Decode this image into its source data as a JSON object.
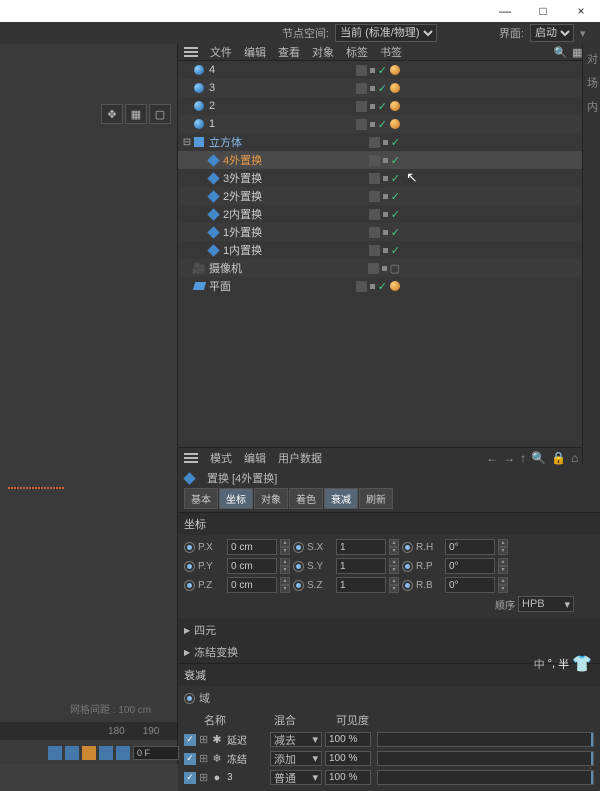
{
  "titlebar": {
    "min": "—",
    "max": "□",
    "close": "×"
  },
  "noderow": {
    "label1": "节点空间:",
    "select1": "当前 (标准/物理)",
    "label2": "界面:",
    "select2": "启动"
  },
  "objmenu": {
    "m1": "文件",
    "m2": "编辑",
    "m3": "查看",
    "m4": "对象",
    "m5": "标签",
    "m6": "书签"
  },
  "tree": {
    "items": [
      {
        "name": "4",
        "type": "sphere",
        "indent": 0
      },
      {
        "name": "3",
        "type": "sphere",
        "indent": 0
      },
      {
        "name": "2",
        "type": "sphere",
        "indent": 0
      },
      {
        "name": "1",
        "type": "sphere",
        "indent": 0
      },
      {
        "name": "立方体",
        "type": "cube",
        "indent": 0,
        "exp": true,
        "blue": true
      },
      {
        "name": "4外置换",
        "type": "def",
        "indent": 1,
        "sel": true,
        "orange": true
      },
      {
        "name": "3外置换",
        "type": "def",
        "indent": 1
      },
      {
        "name": "2外置换",
        "type": "def",
        "indent": 1
      },
      {
        "name": "2内置换",
        "type": "def",
        "indent": 1
      },
      {
        "name": "1外置换",
        "type": "def",
        "indent": 1
      },
      {
        "name": "1内置换",
        "type": "def",
        "indent": 1
      },
      {
        "name": "摄像机",
        "type": "cam",
        "indent": 0
      },
      {
        "name": "平面",
        "type": "plane",
        "indent": 0,
        "mat": true
      }
    ]
  },
  "attrmenu": {
    "m1": "模式",
    "m2": "编辑",
    "m3": "用户数据"
  },
  "attrtitle": "置换 [4外置换]",
  "tabs": {
    "t1": "基本",
    "t2": "坐标",
    "t3": "对象",
    "t4": "着色",
    "t5": "衰减",
    "t6": "刷新"
  },
  "coords": {
    "hdr": "坐标",
    "px": "P.X",
    "py": "P.Y",
    "pz": "P.Z",
    "sx": "S.X",
    "sy": "S.Y",
    "sz": "S.Z",
    "rh": "R.H",
    "rp": "R.P",
    "rb": "R.B",
    "pxv": "0 cm",
    "pyv": "0 cm",
    "pzv": "0 cm",
    "sxv": "1",
    "syv": "1",
    "szv": "1",
    "rhv": "0°",
    "rpv": "0°",
    "rbv": "0°",
    "order": "顺序",
    "orderv": "HPB"
  },
  "quat": "四元",
  "freeze": "冻结变换",
  "falloff": {
    "hdr": "衰减",
    "field": "域",
    "h_name": "名称",
    "h_blend": "混合",
    "h_vis": "可见度",
    "rows": [
      {
        "ic": "✱",
        "name": "延迟",
        "blend": "减去",
        "vis": "100 %"
      },
      {
        "ic": "❄",
        "name": "冻结",
        "blend": "添加",
        "vis": "100 %"
      },
      {
        "ic": "●",
        "name": "3",
        "blend": "普通",
        "vis": "100 %"
      }
    ]
  },
  "gridinfo": "网格间距 : 100 cm",
  "timeline": {
    "t1": "180",
    "t2": "190"
  },
  "ofield": "0 F",
  "status": {
    "a": "中",
    "b": "°,",
    "c": "半"
  }
}
